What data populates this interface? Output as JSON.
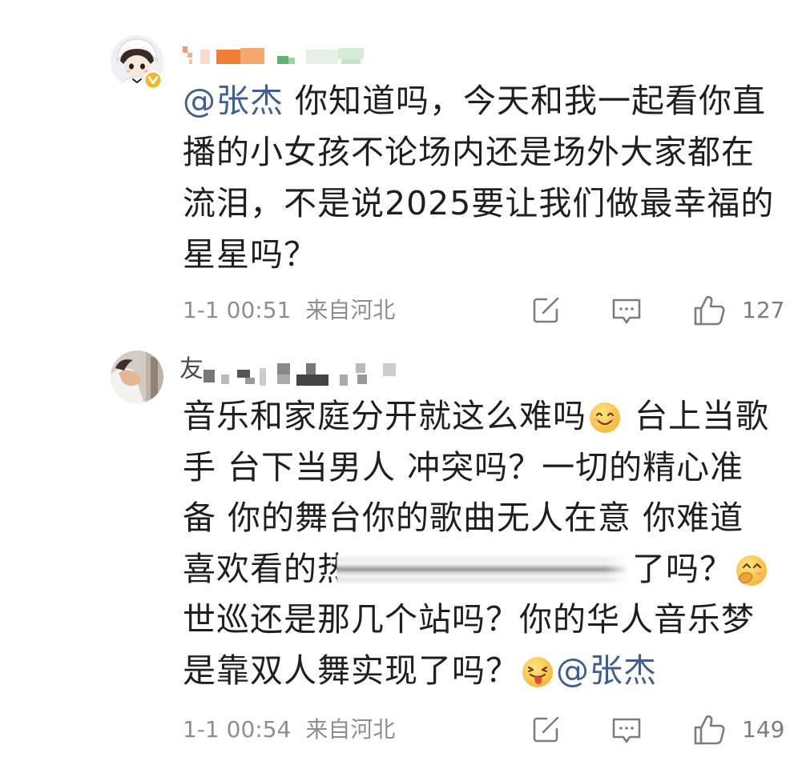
{
  "comments": [
    {
      "lines": [
        {
          "mention": "@张杰",
          "text": " 你知道吗，今天和我一起看你直"
        },
        {
          "text": "播的小女孩不论场内还是场外大家都在"
        },
        {
          "text": "流泪，不是说2025要让我们做最幸福的"
        },
        {
          "text": "星星吗？"
        }
      ],
      "time": "1-1 00:51",
      "location": "来自河北",
      "likes": "127"
    },
    {
      "username_visible": "友",
      "lines": [
        {
          "text": "音乐和家庭分开就这么难吗",
          "emoji": "smile-emoji",
          "text_after": " 台上当歌"
        },
        {
          "text": "手 台下当男人 冲突吗？一切的精心准"
        },
        {
          "text": "备 你的舞台你的歌曲无人在意 你难道"
        },
        {
          "text": "喜欢看的热",
          "text_after": "了吗？",
          "emoji": "giggle-emoji"
        },
        {
          "text": "世巡还是那几个站吗？你的华人音乐梦"
        },
        {
          "text": "是靠双人舞实现了吗？",
          "emoji": "tongue-emoji",
          "mention": "@张杰"
        }
      ],
      "time": "1-1 00:54",
      "location": "来自河北",
      "likes": "149"
    }
  ],
  "icons": {
    "verified": "verified-badge-icon",
    "forward": "forward-icon",
    "comment": "comment-icon",
    "like": "like-icon"
  },
  "colors": {
    "background": "#ffffff",
    "text": "#1f1f1f",
    "mention": "#405f8f",
    "meta": "#8e8e8e",
    "icon": "#7d7d7d",
    "verified": "#f5b72a"
  }
}
